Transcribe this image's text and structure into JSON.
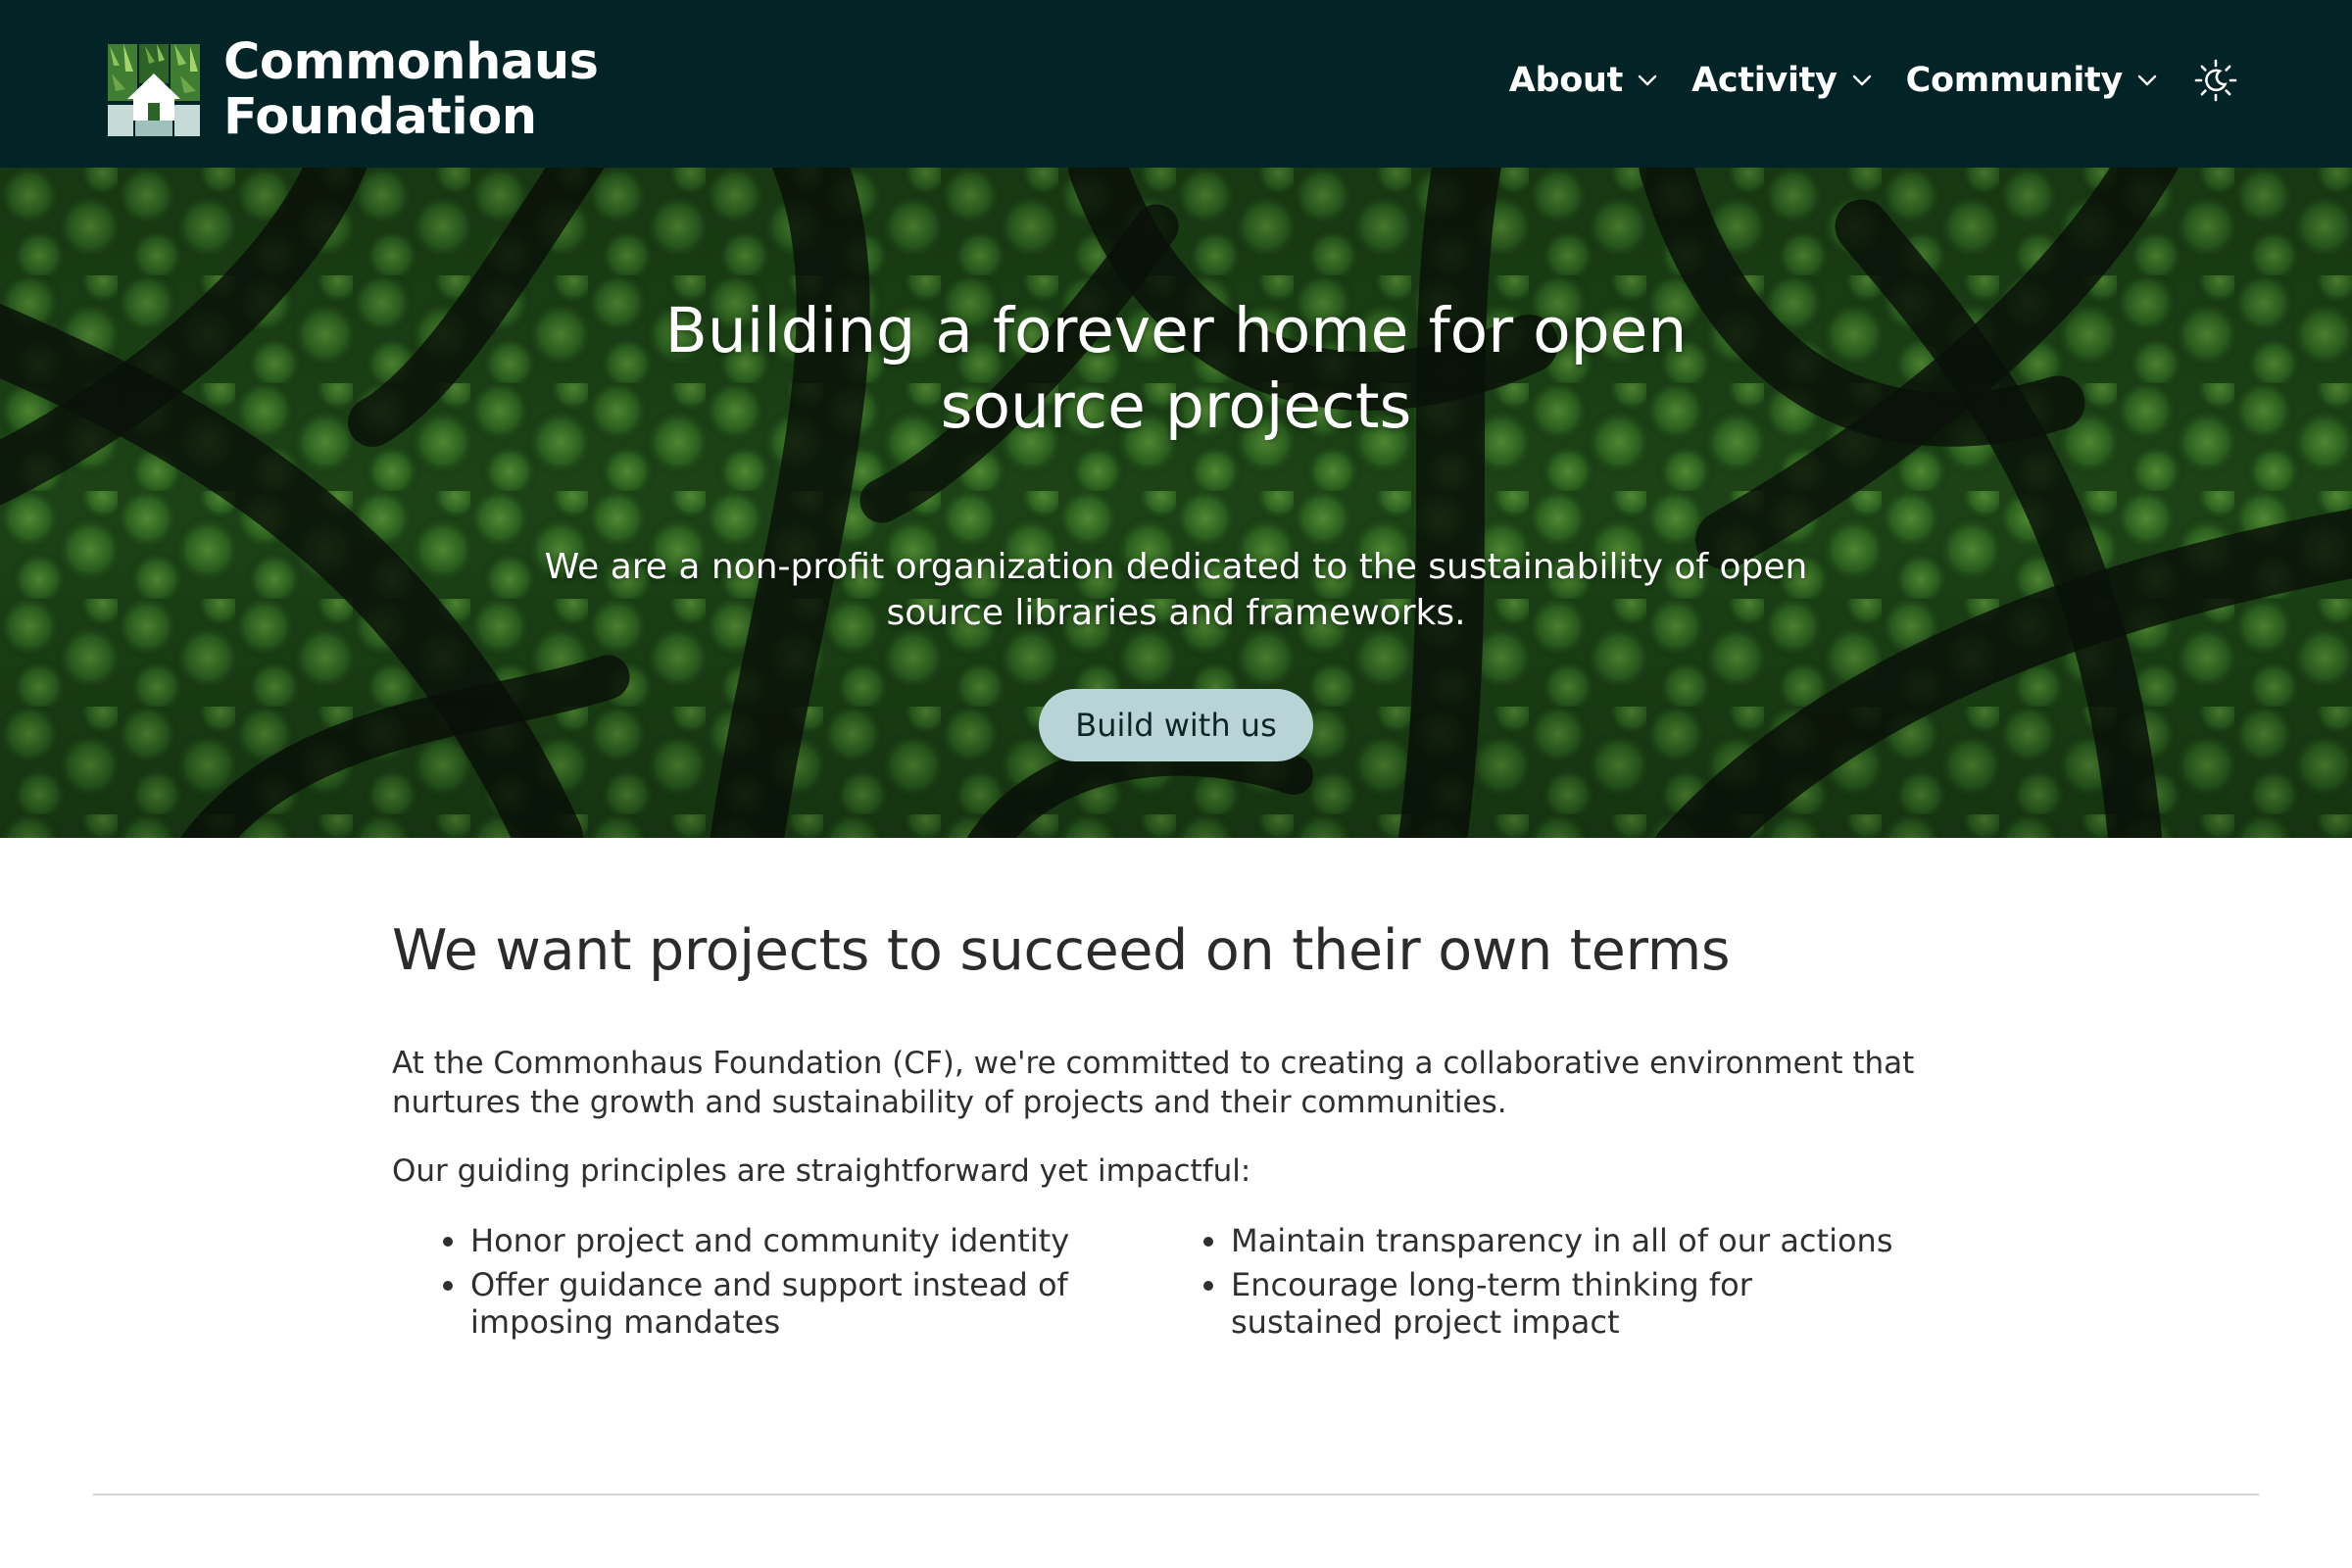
{
  "header": {
    "brand_line1": "Commonhaus",
    "brand_line2": "Foundation",
    "nav": [
      {
        "label": "About"
      },
      {
        "label": "Activity"
      },
      {
        "label": "Community"
      }
    ],
    "theme_toggle_icon": "sun-moon-icon",
    "logo_icon": "commonhaus-logo-icon",
    "colors": {
      "background": "#022427",
      "text": "#ffffff"
    }
  },
  "hero": {
    "title": "Building a forever home for open source projects",
    "subtitle": "We are a non-profit organization dedicated to the sustainability of open source libraries and frameworks.",
    "cta_label": "Build with us",
    "colors": {
      "cta_background": "#b9d4d6",
      "cta_text": "#0f2427",
      "forest": "#2f6a22"
    }
  },
  "intro": {
    "heading": "We want projects to succeed on their own terms",
    "paragraph1": "At the Commonhaus Foundation (CF), we're committed to creating a collaborative environment that nurtures the growth and sustainability of projects and their communities.",
    "paragraph2": "Our guiding principles are straightforward yet impactful:",
    "principles": [
      "Honor project and community identity",
      "Maintain transparency in all of our actions",
      "Offer guidance and support instead of imposing mandates",
      "Encourage long-term thinking for sustained project impact"
    ]
  }
}
